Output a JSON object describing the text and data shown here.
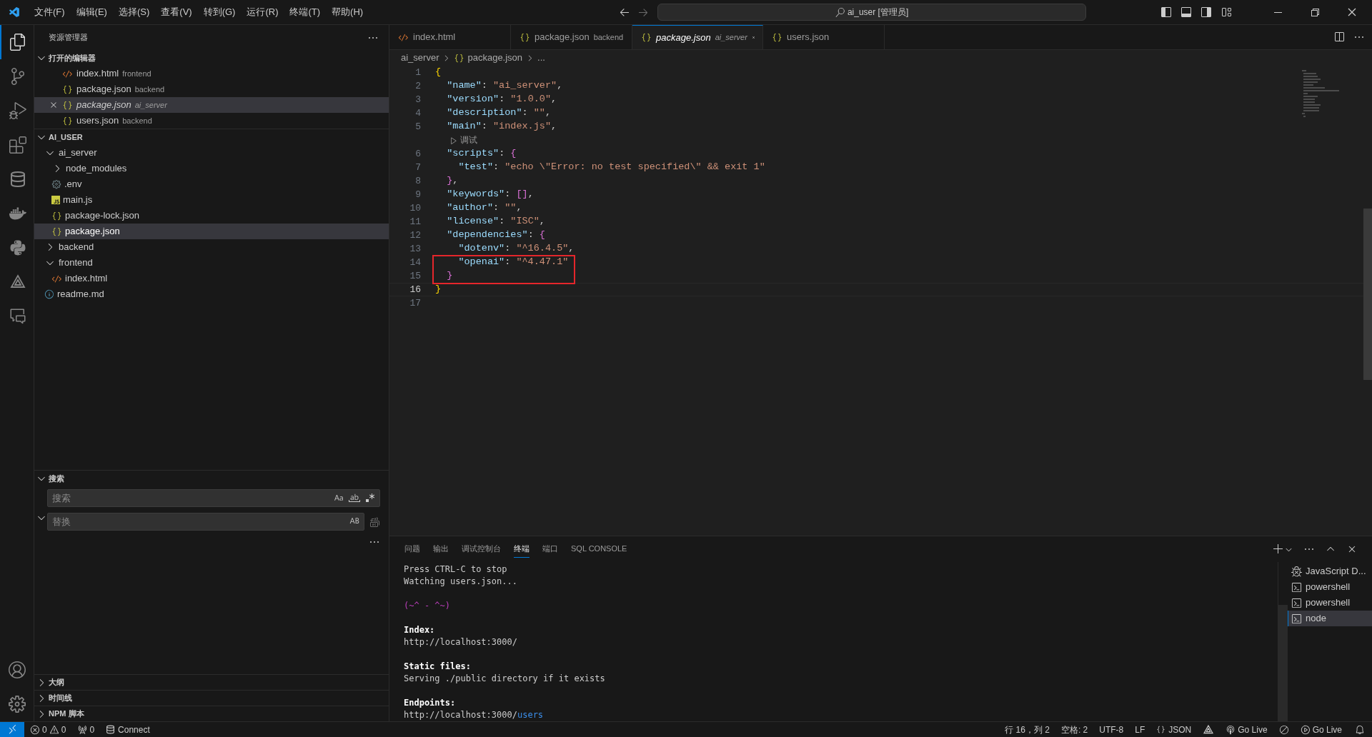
{
  "title_bar": {
    "menus": [
      "文件(F)",
      "编辑(E)",
      "选择(S)",
      "查看(V)",
      "转到(G)",
      "运行(R)",
      "终端(T)",
      "帮助(H)"
    ],
    "command_center": "ai_user [管理员]"
  },
  "activity_bar": {
    "top": [
      {
        "kind": "files",
        "selected": true
      },
      {
        "kind": "source-control",
        "selected": false
      },
      {
        "kind": "run-debug",
        "selected": false
      },
      {
        "kind": "extensions",
        "selected": false
      },
      {
        "kind": "database",
        "selected": false
      },
      {
        "kind": "docker",
        "selected": false
      },
      {
        "kind": "python",
        "selected": false
      },
      {
        "kind": "triangle",
        "selected": false
      },
      {
        "kind": "remote",
        "selected": false
      }
    ],
    "bottom": [
      {
        "kind": "account"
      },
      {
        "kind": "settings"
      }
    ]
  },
  "sidebar": {
    "title": "资源管理器",
    "open_editors": {
      "title": "打开的编辑器",
      "expanded": true,
      "items": [
        {
          "kind": "html",
          "name": "index.html",
          "folder": "frontend",
          "selected": false,
          "preview": false
        },
        {
          "kind": "json",
          "name": "package.json",
          "folder": "backend",
          "selected": false,
          "preview": false
        },
        {
          "kind": "json",
          "name": "package.json",
          "folder": "ai_server",
          "selected": true,
          "preview": true
        },
        {
          "kind": "json",
          "name": "users.json",
          "folder": "backend",
          "selected": false,
          "preview": false
        }
      ]
    },
    "explorer": {
      "title": "AI_USER",
      "expanded": true,
      "children": [
        {
          "kind": "folder",
          "name": "ai_server",
          "expanded": true,
          "selected": false,
          "children": [
            {
              "kind": "folder",
              "name": "node_modules",
              "expanded": false,
              "selected": false
            },
            {
              "kind": "env",
              "name": ".env",
              "selected": false
            },
            {
              "kind": "js",
              "name": "main.js",
              "selected": false
            },
            {
              "kind": "json",
              "name": "package-lock.json",
              "selected": false
            },
            {
              "kind": "json",
              "name": "package.json",
              "selected": true
            }
          ]
        },
        {
          "kind": "folder",
          "name": "backend",
          "expanded": false,
          "selected": false
        },
        {
          "kind": "folder",
          "name": "frontend",
          "expanded": true,
          "selected": false,
          "children": [
            {
              "kind": "html",
              "name": "index.html",
              "selected": false
            }
          ]
        },
        {
          "kind": "info",
          "name": "readme.md",
          "selected": false
        }
      ]
    },
    "search": {
      "title": "搜索",
      "expanded": true,
      "search_placeholder": "搜索",
      "replace_placeholder": "替换",
      "replace_expanded": true
    },
    "sections": [
      {
        "title": "大纲",
        "expanded": false
      },
      {
        "title": "时间线",
        "expanded": false
      },
      {
        "title": "NPM 脚本",
        "expanded": false
      }
    ]
  },
  "tabs": [
    {
      "kind": "html",
      "name": "index.html",
      "selected": false,
      "preview": false
    },
    {
      "kind": "json",
      "name": "package.json",
      "folder": "backend",
      "selected": false,
      "preview": false
    },
    {
      "kind": "json",
      "name": "package.json",
      "folder": "ai_server",
      "selected": true,
      "preview": true
    },
    {
      "kind": "json",
      "name": "users.json",
      "selected": false,
      "preview": false
    }
  ],
  "breadcrumb": [
    {
      "kind": "folder",
      "text": "ai_server"
    },
    {
      "kind": "json",
      "text": "package.json"
    },
    {
      "kind": "more",
      "text": "..."
    }
  ],
  "code_lines": [
    {
      "kind": "code",
      "number": "1",
      "current": false,
      "boxed": false,
      "tokens": [
        {
          "kind": "brace1",
          "text": "{"
        }
      ]
    },
    {
      "kind": "code",
      "number": "2",
      "current": false,
      "boxed": false,
      "tokens": [
        {
          "kind": "key",
          "text": "  \"name\""
        },
        {
          "kind": "punct",
          "text": ": "
        },
        {
          "kind": "string",
          "text": "\"ai_server\""
        },
        {
          "kind": "punct",
          "text": ","
        }
      ]
    },
    {
      "kind": "code",
      "number": "3",
      "current": false,
      "boxed": false,
      "tokens": [
        {
          "kind": "key",
          "text": "  \"version\""
        },
        {
          "kind": "punct",
          "text": ": "
        },
        {
          "kind": "string",
          "text": "\"1.0.0\""
        },
        {
          "kind": "punct",
          "text": ","
        }
      ]
    },
    {
      "kind": "code",
      "number": "4",
      "current": false,
      "boxed": false,
      "tokens": [
        {
          "kind": "key",
          "text": "  \"description\""
        },
        {
          "kind": "punct",
          "text": ": "
        },
        {
          "kind": "string",
          "text": "\"\""
        },
        {
          "kind": "punct",
          "text": ","
        }
      ]
    },
    {
      "kind": "code",
      "number": "5",
      "current": false,
      "boxed": false,
      "tokens": [
        {
          "kind": "key",
          "text": "  \"main\""
        },
        {
          "kind": "punct",
          "text": ": "
        },
        {
          "kind": "string",
          "text": "\"index.js\""
        },
        {
          "kind": "punct",
          "text": ","
        }
      ]
    },
    {
      "kind": "codelens",
      "text": "调试"
    },
    {
      "kind": "code",
      "number": "6",
      "current": false,
      "boxed": false,
      "tokens": [
        {
          "kind": "key",
          "text": "  \"scripts\""
        },
        {
          "kind": "punct",
          "text": ": "
        },
        {
          "kind": "brace2",
          "text": "{"
        }
      ]
    },
    {
      "kind": "code",
      "number": "7",
      "current": false,
      "boxed": false,
      "tokens": [
        {
          "kind": "key",
          "text": "    \"test\""
        },
        {
          "kind": "punct",
          "text": ": "
        },
        {
          "kind": "string",
          "text": "\"echo \\\"Error: no test specified\\\" && exit 1\""
        }
      ]
    },
    {
      "kind": "code",
      "number": "8",
      "current": false,
      "boxed": false,
      "tokens": [
        {
          "kind": "brace2",
          "text": "  }"
        },
        {
          "kind": "punct",
          "text": ","
        }
      ]
    },
    {
      "kind": "code",
      "number": "9",
      "current": false,
      "boxed": false,
      "tokens": [
        {
          "kind": "key",
          "text": "  \"keywords\""
        },
        {
          "kind": "punct",
          "text": ": "
        },
        {
          "kind": "brace2",
          "text": "[]"
        },
        {
          "kind": "punct",
          "text": ","
        }
      ]
    },
    {
      "kind": "code",
      "number": "10",
      "current": false,
      "boxed": false,
      "tokens": [
        {
          "kind": "key",
          "text": "  \"author\""
        },
        {
          "kind": "punct",
          "text": ": "
        },
        {
          "kind": "string",
          "text": "\"\""
        },
        {
          "kind": "punct",
          "text": ","
        }
      ]
    },
    {
      "kind": "code",
      "number": "11",
      "current": false,
      "boxed": false,
      "tokens": [
        {
          "kind": "key",
          "text": "  \"license\""
        },
        {
          "kind": "punct",
          "text": ": "
        },
        {
          "kind": "string",
          "text": "\"ISC\""
        },
        {
          "kind": "punct",
          "text": ","
        }
      ]
    },
    {
      "kind": "code",
      "number": "12",
      "current": false,
      "boxed": false,
      "tokens": [
        {
          "kind": "key",
          "text": "  \"dependencies\""
        },
        {
          "kind": "punct",
          "text": ": "
        },
        {
          "kind": "brace2",
          "text": "{"
        }
      ]
    },
    {
      "kind": "code",
      "number": "13",
      "current": false,
      "boxed": false,
      "tokens": [
        {
          "kind": "key",
          "text": "    \"dotenv\""
        },
        {
          "kind": "punct",
          "text": ": "
        },
        {
          "kind": "string",
          "text": "\"^16.4.5\""
        },
        {
          "kind": "punct",
          "text": ","
        }
      ]
    },
    {
      "kind": "code",
      "number": "14",
      "current": false,
      "boxed": true,
      "tokens": [
        {
          "kind": "key",
          "text": "    \"openai\""
        },
        {
          "kind": "punct",
          "text": ": "
        },
        {
          "kind": "string",
          "text": "\"^4.47.1\""
        }
      ]
    },
    {
      "kind": "code",
      "number": "15",
      "current": false,
      "boxed": true,
      "tokens": [
        {
          "kind": "brace2",
          "text": "  }"
        }
      ]
    },
    {
      "kind": "code",
      "number": "16",
      "current": true,
      "boxed": false,
      "tokens": [
        {
          "kind": "brace1",
          "text": "}"
        }
      ]
    },
    {
      "kind": "code",
      "number": "17",
      "current": false,
      "boxed": false
    }
  ],
  "panel": {
    "tabs": [
      {
        "label": "问题",
        "selected": false
      },
      {
        "label": "输出",
        "selected": false
      },
      {
        "label": "调试控制台",
        "selected": false
      },
      {
        "label": "终端",
        "selected": true
      },
      {
        "label": "端口",
        "selected": false
      },
      {
        "label": "SQL CONSOLE",
        "selected": false
      }
    ],
    "terminal_lines": [
      {
        "kind": "plain",
        "text": "Press CTRL-C to stop"
      },
      {
        "kind": "plain",
        "text": "Watching users.json..."
      },
      {
        "kind": "blank"
      },
      {
        "kind": "accent",
        "text": "(~^ - ^~)"
      },
      {
        "kind": "blank"
      },
      {
        "kind": "heading",
        "text": "Index:"
      },
      {
        "kind": "plain",
        "text": "http://localhost:3000/"
      },
      {
        "kind": "blank"
      },
      {
        "kind": "heading",
        "text": "Static files:"
      },
      {
        "kind": "plain",
        "text": "Serving ./public directory if it exists"
      },
      {
        "kind": "blank"
      },
      {
        "kind": "heading",
        "text": "Endpoints:"
      },
      {
        "kind": "url",
        "text": "http://localhost:3000/",
        "link": "users"
      }
    ],
    "terminals": [
      {
        "kind": "debug",
        "name": "JavaScript D...",
        "selected": false
      },
      {
        "kind": "shell",
        "name": "powershell",
        "selected": false
      },
      {
        "kind": "shell",
        "name": "powershell",
        "selected": false
      },
      {
        "kind": "shell",
        "name": "node",
        "selected": true
      }
    ]
  },
  "status_bar": {
    "left": [
      {
        "kind": "problems",
        "errors": "0",
        "warnings": "0"
      },
      {
        "kind": "ports",
        "text": "0"
      },
      {
        "kind": "connect",
        "text": "Connect"
      }
    ],
    "right": [
      {
        "kind": "text",
        "text": "行 16，列 2"
      },
      {
        "kind": "text",
        "text": "空格: 2"
      },
      {
        "kind": "text",
        "text": "UTF-8"
      },
      {
        "kind": "text",
        "text": "LF"
      },
      {
        "kind": "language",
        "text": "JSON"
      },
      {
        "kind": "triangle"
      },
      {
        "kind": "broadcast",
        "text": "Go Live"
      },
      {
        "kind": "slash"
      },
      {
        "kind": "play",
        "text": "Go Live"
      },
      {
        "kind": "bell"
      }
    ]
  }
}
